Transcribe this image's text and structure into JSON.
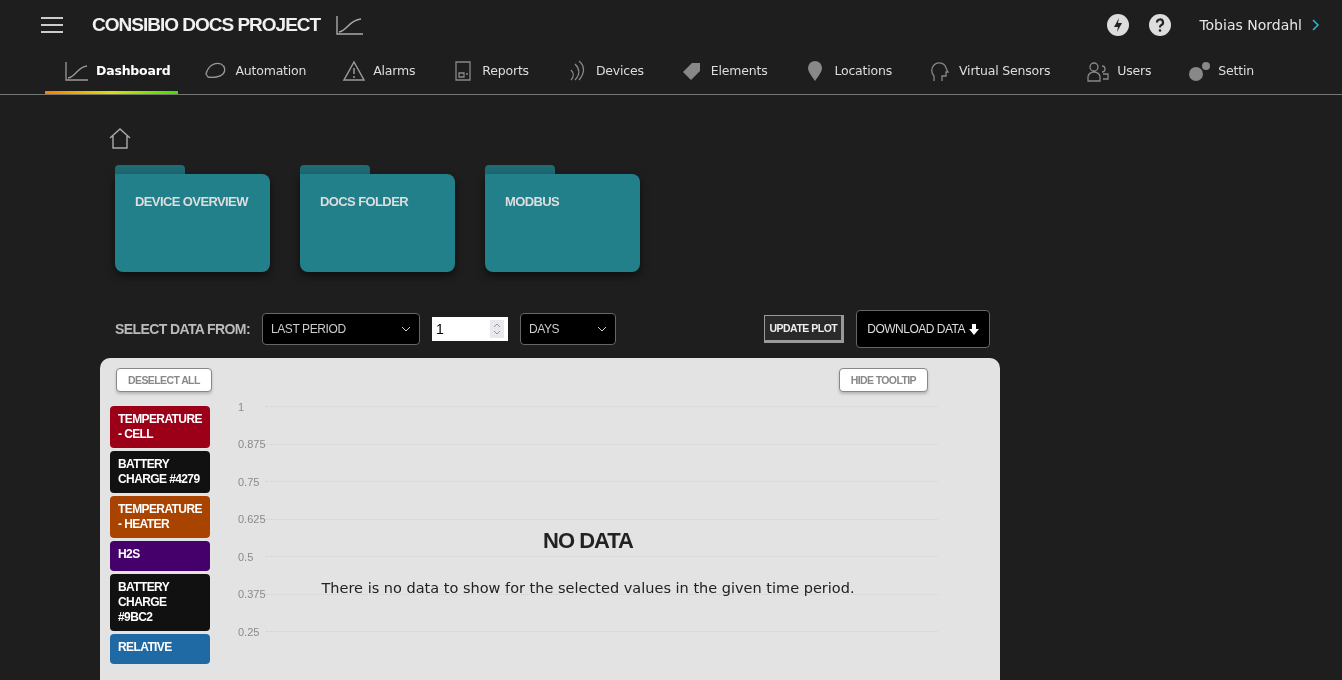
{
  "header": {
    "title": "CONSIBIO DOCS PROJECT",
    "user": "Tobias Nordahl"
  },
  "nav": [
    {
      "label": "Dashboard",
      "selected": true
    },
    {
      "label": "Automation",
      "selected": false
    },
    {
      "label": "Alarms",
      "selected": false
    },
    {
      "label": "Reports",
      "selected": false
    },
    {
      "label": "Devices",
      "selected": false
    },
    {
      "label": "Elements",
      "selected": false
    },
    {
      "label": "Locations",
      "selected": false
    },
    {
      "label": "Virtual Sensors",
      "selected": false
    },
    {
      "label": "Users",
      "selected": false
    },
    {
      "label": "Settin",
      "selected": false
    }
  ],
  "folders": [
    {
      "label": "DEVICE OVERVIEW"
    },
    {
      "label": "DOCS FOLDER"
    },
    {
      "label": "MODBUS"
    }
  ],
  "controls": {
    "label": "SELECT DATA FROM:",
    "source": "LAST PERIOD",
    "count": "1",
    "unit": "DAYS",
    "update_button": "UPDATE PLOT",
    "download_button": "DOWNLOAD DATA"
  },
  "panel": {
    "deselect_button": "DESELECT ALL",
    "tooltip_button": "HIDE TOOLTIP",
    "legend": [
      {
        "label": "TEMPERATURE - CELL",
        "color": "#9b0018"
      },
      {
        "label": "BATTERY CHARGE #4279",
        "color": "#111111"
      },
      {
        "label": "TEMPERATURE - HEATER",
        "color": "#a84300"
      },
      {
        "label": "H2S",
        "color": "#45006b"
      },
      {
        "label": "BATTERY CHARGE #9BC2",
        "color": "#111111"
      },
      {
        "label": "RELATIVE",
        "color": "#1f6aa5"
      }
    ],
    "y_ticks": [
      "1",
      "0.875",
      "0.75",
      "0.625",
      "0.5",
      "0.375",
      "0.25"
    ],
    "empty_title": "NO DATA",
    "empty_message": "There is no data to show for the selected values in the given time period."
  }
}
